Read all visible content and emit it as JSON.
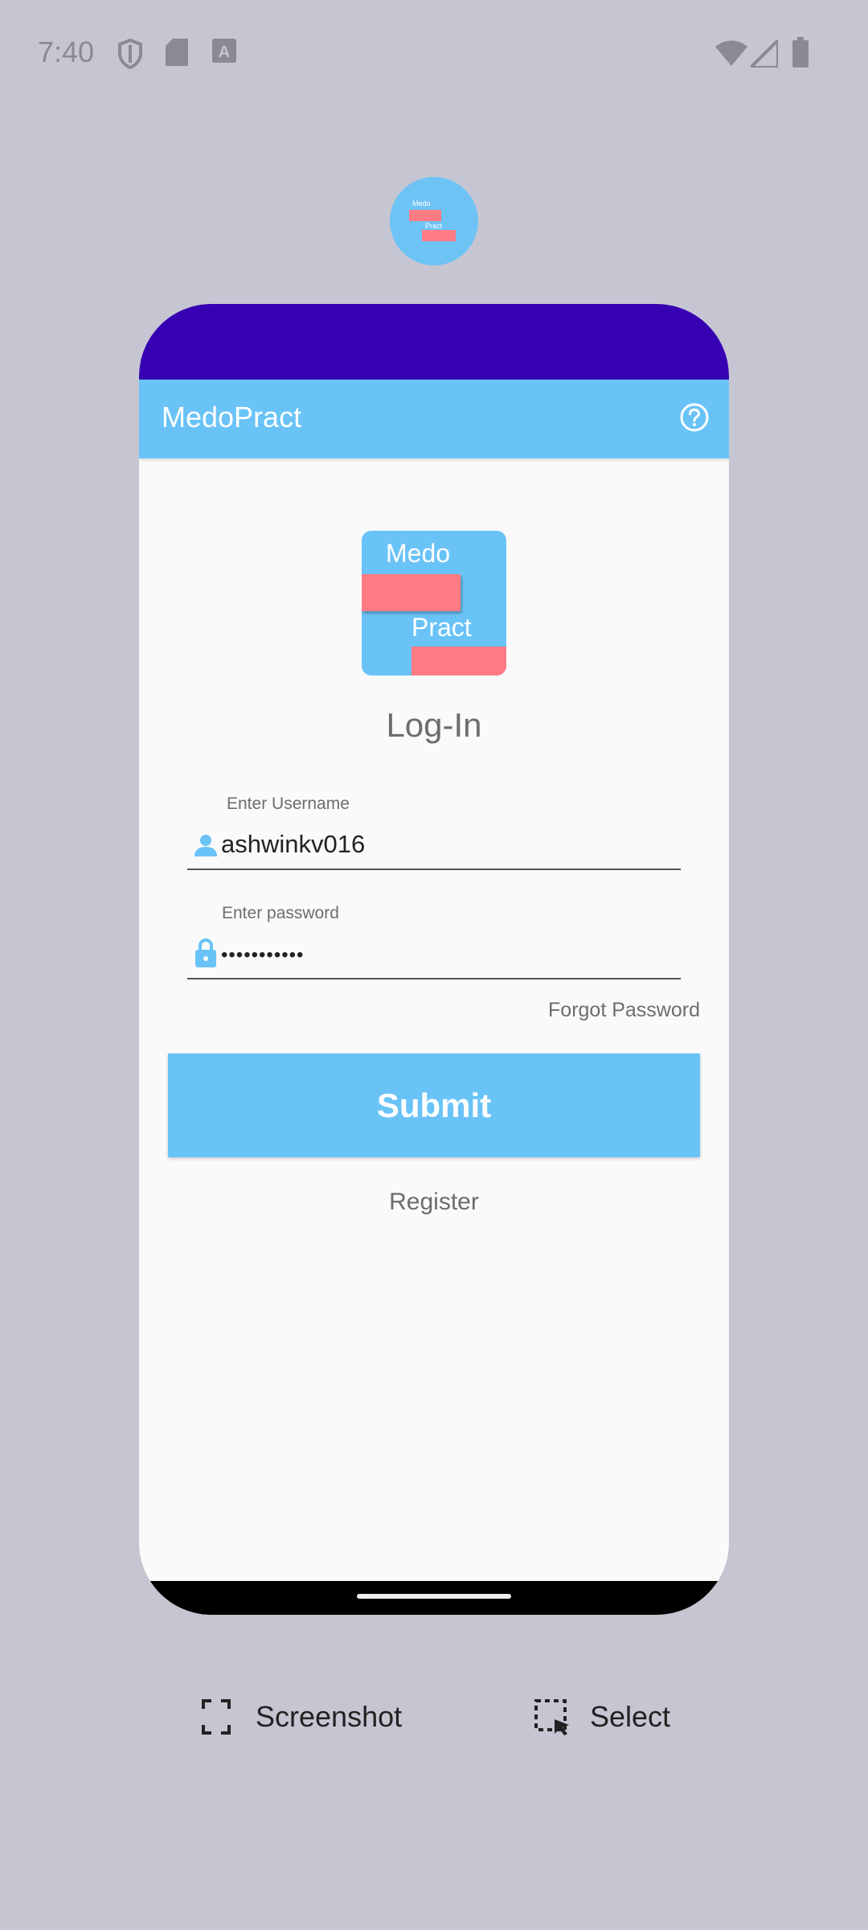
{
  "status_bar": {
    "time": "7:40",
    "icons": [
      "shield-icon",
      "sd-card-icon",
      "a-text-icon",
      "wifi-icon",
      "signal-icon",
      "battery-icon"
    ]
  },
  "app": {
    "title": "MedoPract",
    "logo_top_text": "Medo",
    "logo_bottom_text": "Pract",
    "small_logo_top_text": "Medo",
    "small_logo_bottom_text": "Pract"
  },
  "login": {
    "heading": "Log-In",
    "username_label": "Enter Username",
    "username_value": "ashwinkv016",
    "password_label": "Enter password",
    "password_value": "•••••••••••",
    "forgot_label": "Forgot Password",
    "submit_label": "Submit",
    "register_label": "Register"
  },
  "actions": {
    "screenshot_label": "Screenshot",
    "select_label": "Select"
  },
  "colors": {
    "accent": "#6ac3f7",
    "status_bar": "#3700b3",
    "logo_bar": "#ff7b84",
    "background": "#c6c6d2"
  }
}
